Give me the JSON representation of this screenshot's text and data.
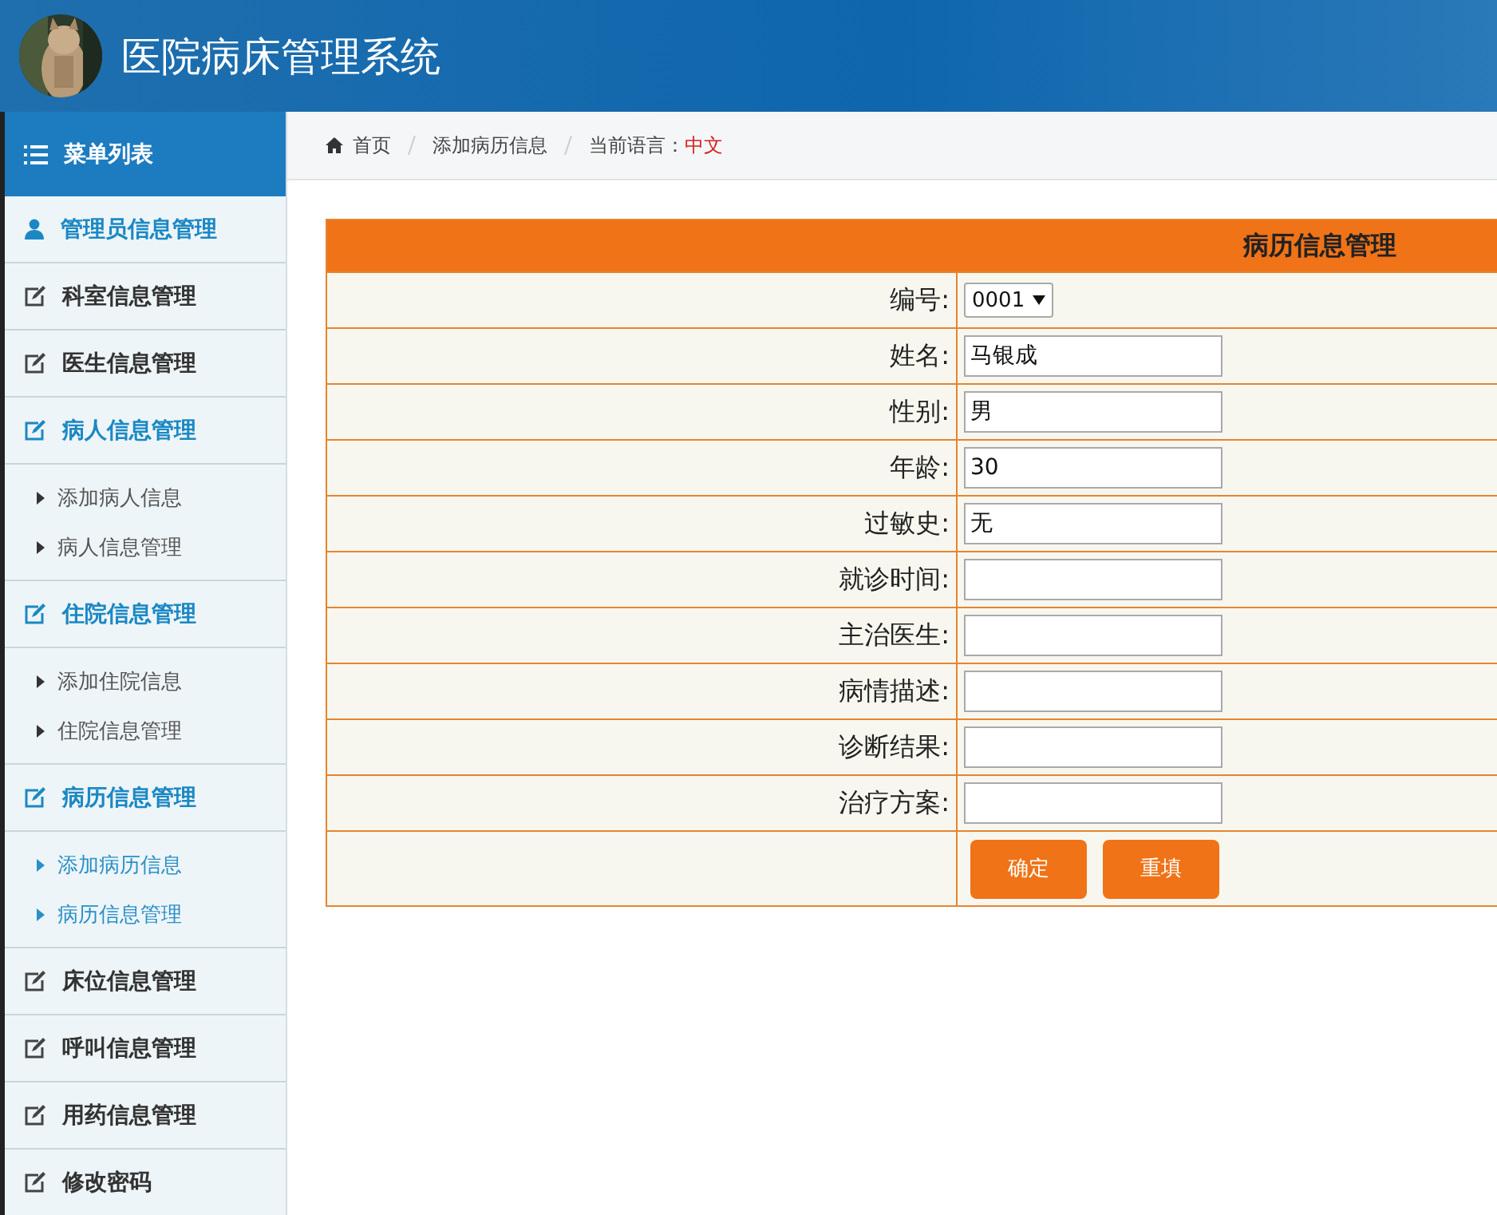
{
  "header": {
    "title": "医院病床管理系统"
  },
  "sidebar": {
    "title": "菜单列表",
    "sections": [
      {
        "label": "管理员信息管理",
        "expanded": true
      },
      {
        "label": "科室信息管理",
        "expanded": false
      },
      {
        "label": "医生信息管理",
        "expanded": false
      },
      {
        "label": "病人信息管理",
        "expanded": true,
        "children": [
          {
            "label": "添加病人信息",
            "selected": false
          },
          {
            "label": "病人信息管理",
            "selected": false
          }
        ]
      },
      {
        "label": "住院信息管理",
        "expanded": true,
        "children": [
          {
            "label": "添加住院信息",
            "selected": false
          },
          {
            "label": "住院信息管理",
            "selected": false
          }
        ]
      },
      {
        "label": "病历信息管理",
        "expanded": true,
        "children": [
          {
            "label": "添加病历信息",
            "selected": true
          },
          {
            "label": "病历信息管理",
            "selected": true
          }
        ]
      },
      {
        "label": "床位信息管理",
        "expanded": false
      },
      {
        "label": "呼叫信息管理",
        "expanded": false
      },
      {
        "label": "用药信息管理",
        "expanded": false
      },
      {
        "label": "修改密码",
        "expanded": false
      }
    ]
  },
  "breadcrumb": {
    "items": [
      "首页",
      "添加病历信息"
    ],
    "language_label": "当前语言：",
    "language_value": "中文"
  },
  "form": {
    "title": "病历信息管理",
    "fields": [
      {
        "label": "编号:",
        "kind": "select",
        "value": "0001"
      },
      {
        "label": "姓名:",
        "kind": "text",
        "value": "马银成"
      },
      {
        "label": "性别:",
        "kind": "text",
        "value": "男"
      },
      {
        "label": "年龄:",
        "kind": "text",
        "value": "30"
      },
      {
        "label": "过敏史:",
        "kind": "text",
        "value": "无"
      },
      {
        "label": "就诊时间:",
        "kind": "text"
      },
      {
        "label": "主治医生:",
        "kind": "text"
      },
      {
        "label": "病情描述:",
        "kind": "text"
      },
      {
        "label": "诊断结果:",
        "kind": "text"
      },
      {
        "label": "治疗方案:",
        "kind": "text"
      }
    ],
    "buttons": [
      "确定",
      "重填"
    ]
  }
}
